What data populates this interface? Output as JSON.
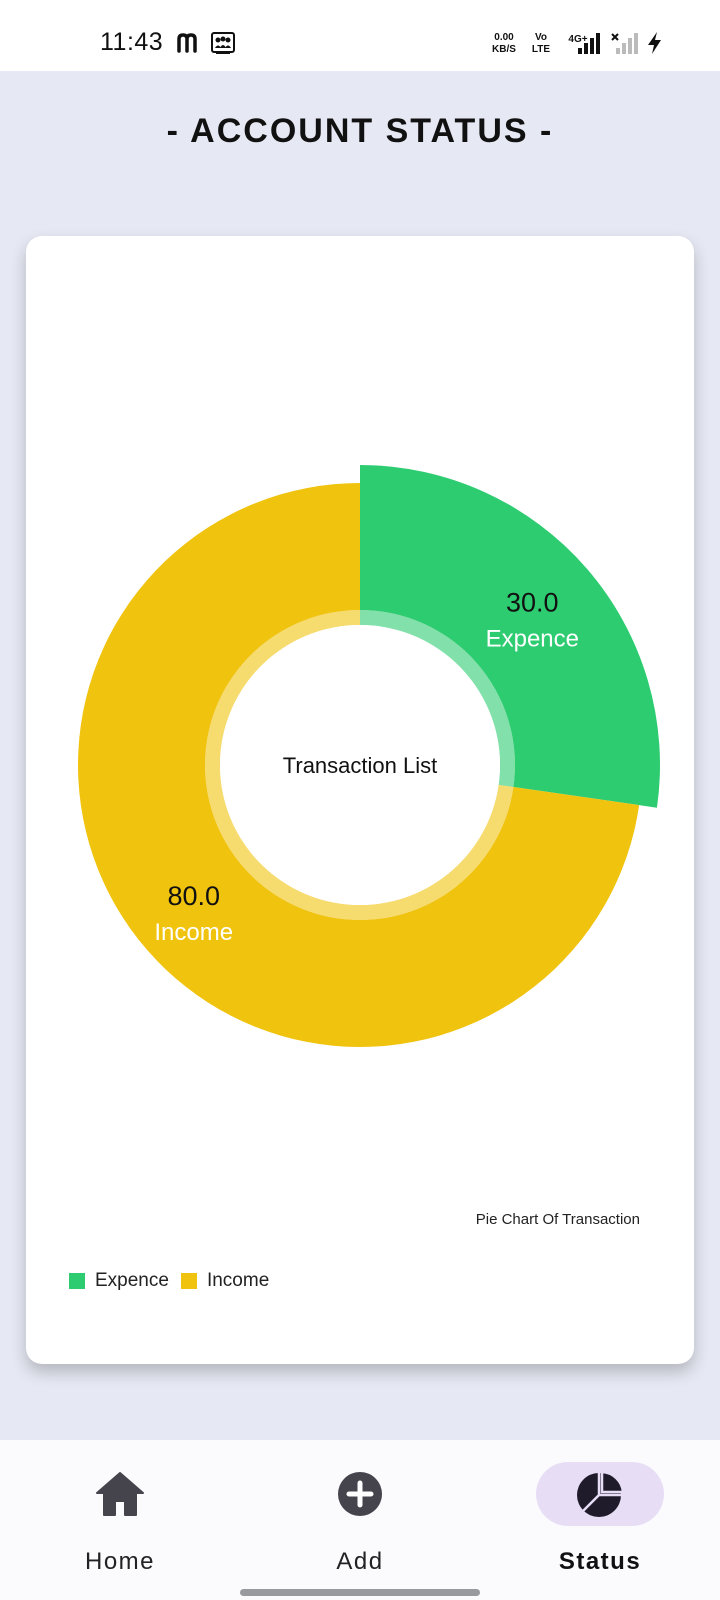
{
  "status_bar": {
    "time": "11:43",
    "net_speed_value": "0.00",
    "net_speed_unit": "KB/S",
    "volte_top": "Vo",
    "volte_bottom": "LTE",
    "network_type": "4G+",
    "left_icons": [
      "m-app-icon",
      "team-icon"
    ],
    "right_icons": [
      "signal-icon",
      "signal-off-icon",
      "charging-icon"
    ]
  },
  "header": {
    "title": "- ACCOUNT STATUS -"
  },
  "chart_data": {
    "type": "pie",
    "style": "donut",
    "center_text": "Transaction List",
    "description": "Pie Chart Of Transaction",
    "slices": [
      {
        "label": "Expence",
        "value": 30.0,
        "value_text": "30.0",
        "color": "#2ecc71",
        "highlighted": true
      },
      {
        "label": "Income",
        "value": 80.0,
        "value_text": "80.0",
        "color": "#f0c30f",
        "highlighted": false
      }
    ],
    "legend": [
      {
        "label": "Expence",
        "color": "#2ecc71"
      },
      {
        "label": "Income",
        "color": "#f0c30f"
      }
    ],
    "legend_position": "bottom-left"
  },
  "bottom_nav": {
    "items": [
      {
        "label": "Home",
        "icon": "home-icon",
        "active": false
      },
      {
        "label": "Add",
        "icon": "add-circle-icon",
        "active": false
      },
      {
        "label": "Status",
        "icon": "pie-chart-icon",
        "active": true
      }
    ]
  },
  "colors": {
    "background": "#e6e8f3",
    "card": "#ffffff",
    "expence": "#2ecc71",
    "income": "#f0c30f",
    "nav_active_indicator": "#e7def6",
    "icon_dark": "#45434c"
  }
}
